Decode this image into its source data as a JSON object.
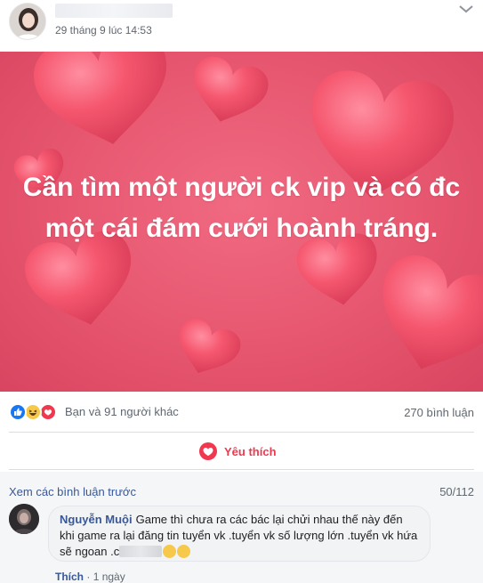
{
  "post": {
    "author_name": "",
    "timestamp": "29 tháng 9 lúc 14:53",
    "hero_text": "Cần tìm một người ck vip và có đc một cái đám cưới hoành tráng."
  },
  "reactions": {
    "summary": "Bạn và 91 người khác",
    "comment_count": "270 bình luận"
  },
  "actions": {
    "like_label": "Yêu thích"
  },
  "comments": {
    "view_previous": "Xem các bình luận trước",
    "page_count": "50/112",
    "items": [
      {
        "author": "Nguyễn Muội",
        "text": "Game thì chưa ra các bác lại chửi nhau thế này đến khi game ra lại đăng tin tuyển vk .tuyển vk số lượng lớn .tuyển vk hứa sẽ ngoan .c",
        "like_label": "Thích",
        "time": "1 ngày"
      }
    ]
  },
  "colors": {
    "hero_background": "#e7566f",
    "heart": "#f24d68",
    "link": "#385898",
    "love_red": "#f0384f",
    "like_blue": "#1877f2"
  },
  "icons": [
    "more-icon",
    "like-reaction-icon",
    "haha-reaction-icon",
    "love-reaction-icon",
    "heart-icon",
    "smirk-emoji-icon"
  ]
}
